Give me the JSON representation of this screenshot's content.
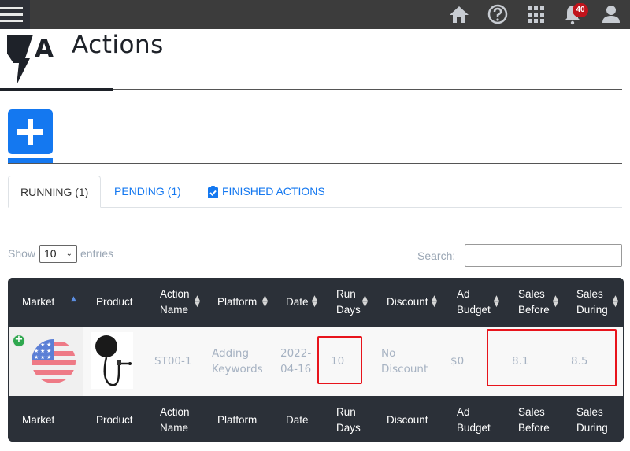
{
  "topbar": {
    "icons": [
      "menu-icon",
      "home-icon",
      "help-icon",
      "apps-grid-icon",
      "bell-icon",
      "user-icon"
    ],
    "notification_count": "40",
    "colors": {
      "bar": "#3c3c3c",
      "badge": "#c0141c"
    }
  },
  "header": {
    "logo_letter": "A",
    "title": "Actions"
  },
  "add_button": {
    "icon": "plus-icon",
    "color": "#1478f0"
  },
  "tabs": [
    {
      "label": "RUNNING (1)",
      "active": true
    },
    {
      "label": "PENDING (1)",
      "active": false
    },
    {
      "label": "FINISHED ACTIONS",
      "active": false,
      "icon": "clipboard-check-icon"
    }
  ],
  "table_controls": {
    "show_label": "Show",
    "entries_value": "10",
    "entries_label": "entries",
    "search_label": "Search:",
    "search_value": ""
  },
  "table": {
    "columns": [
      {
        "line1": "Market",
        "line2": "",
        "sort": "asc"
      },
      {
        "line1": "Product",
        "line2": "",
        "sort": "none"
      },
      {
        "line1": "Action",
        "line2": "Name",
        "sort": "both"
      },
      {
        "line1": "Platform",
        "line2": "",
        "sort": "both"
      },
      {
        "line1": "Date",
        "line2": "",
        "sort": "both"
      },
      {
        "line1": "Run",
        "line2": "Days",
        "sort": "both"
      },
      {
        "line1": "Discount",
        "line2": "",
        "sort": "both"
      },
      {
        "line1": "Ad",
        "line2": "Budget",
        "sort": "both"
      },
      {
        "line1": "Sales",
        "line2": "Before",
        "sort": "both"
      },
      {
        "line1": "Sales",
        "line2": "During",
        "sort": "both"
      }
    ],
    "rows": [
      {
        "market": "us-flag",
        "product": "pop-filter-image",
        "action_name": "ST00-1",
        "platform_line1": "Adding",
        "platform_line2": "Keywords",
        "date_line1": "2022-",
        "date_line2": "04-16",
        "run_days": "10",
        "discount_line1": "No",
        "discount_line2": "Discount",
        "ad_budget": "$0",
        "sales_before": "8.1",
        "sales_during": "8.5"
      }
    ]
  }
}
